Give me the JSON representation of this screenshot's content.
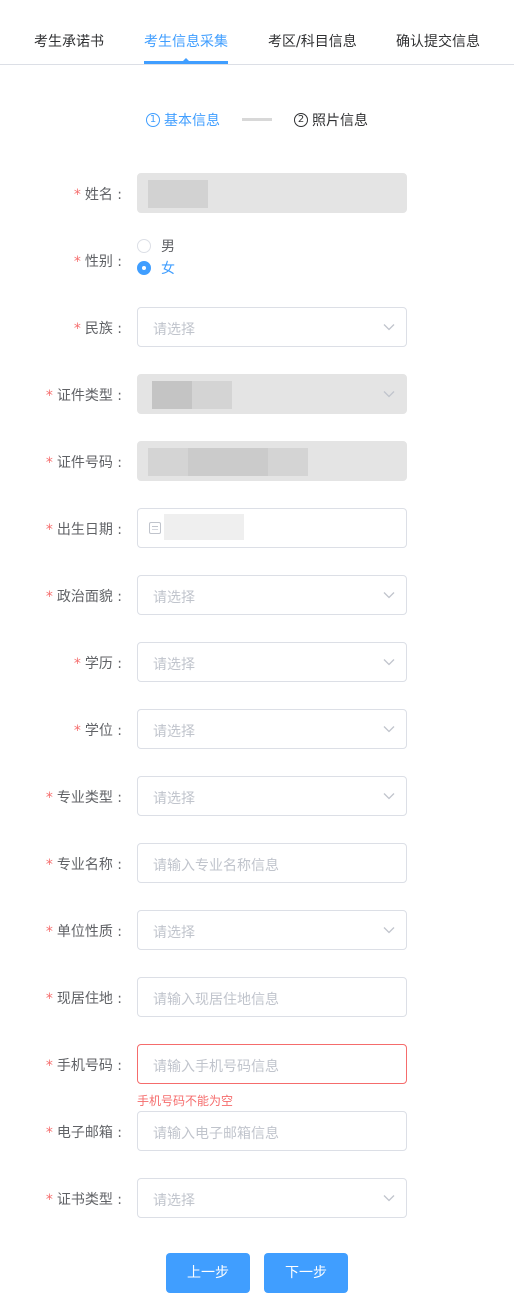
{
  "tabs": [
    {
      "label": "考生承诺书"
    },
    {
      "label": "考生信息采集"
    },
    {
      "label": "考区/科目信息"
    },
    {
      "label": "确认提交信息"
    }
  ],
  "steps": [
    {
      "num": "1",
      "label": "基本信息"
    },
    {
      "num": "2",
      "label": "照片信息"
    }
  ],
  "form": {
    "required_mark": "*",
    "name_label": "姓名 :",
    "gender_label": "性别 :",
    "gender_options": [
      "男",
      "女"
    ],
    "gender_selected": "女",
    "ethnicity_label": "民族 :",
    "id_type_label": "证件类型 :",
    "id_number_label": "证件号码 :",
    "birth_label": "出生日期 :",
    "political_label": "政治面貌 :",
    "education_label": "学历 :",
    "degree_label": "学位 :",
    "major_type_label": "专业类型 :",
    "major_name_label": "专业名称 :",
    "employer_type_label": "单位性质 :",
    "address_label": "现居住地 :",
    "phone_label": "手机号码 :",
    "email_label": "电子邮箱 :",
    "cert_type_label": "证书类型 :",
    "select_placeholder": "请选择",
    "major_name_placeholder": "请输入专业名称信息",
    "address_placeholder": "请输入现居住地信息",
    "phone_placeholder": "请输入手机号码信息",
    "phone_error": "手机号码不能为空",
    "email_placeholder": "请输入电子邮箱信息"
  },
  "buttons": {
    "prev": "上一步",
    "next": "下一步"
  },
  "colors": {
    "accent": "#409eff",
    "error": "#f56c6c"
  }
}
